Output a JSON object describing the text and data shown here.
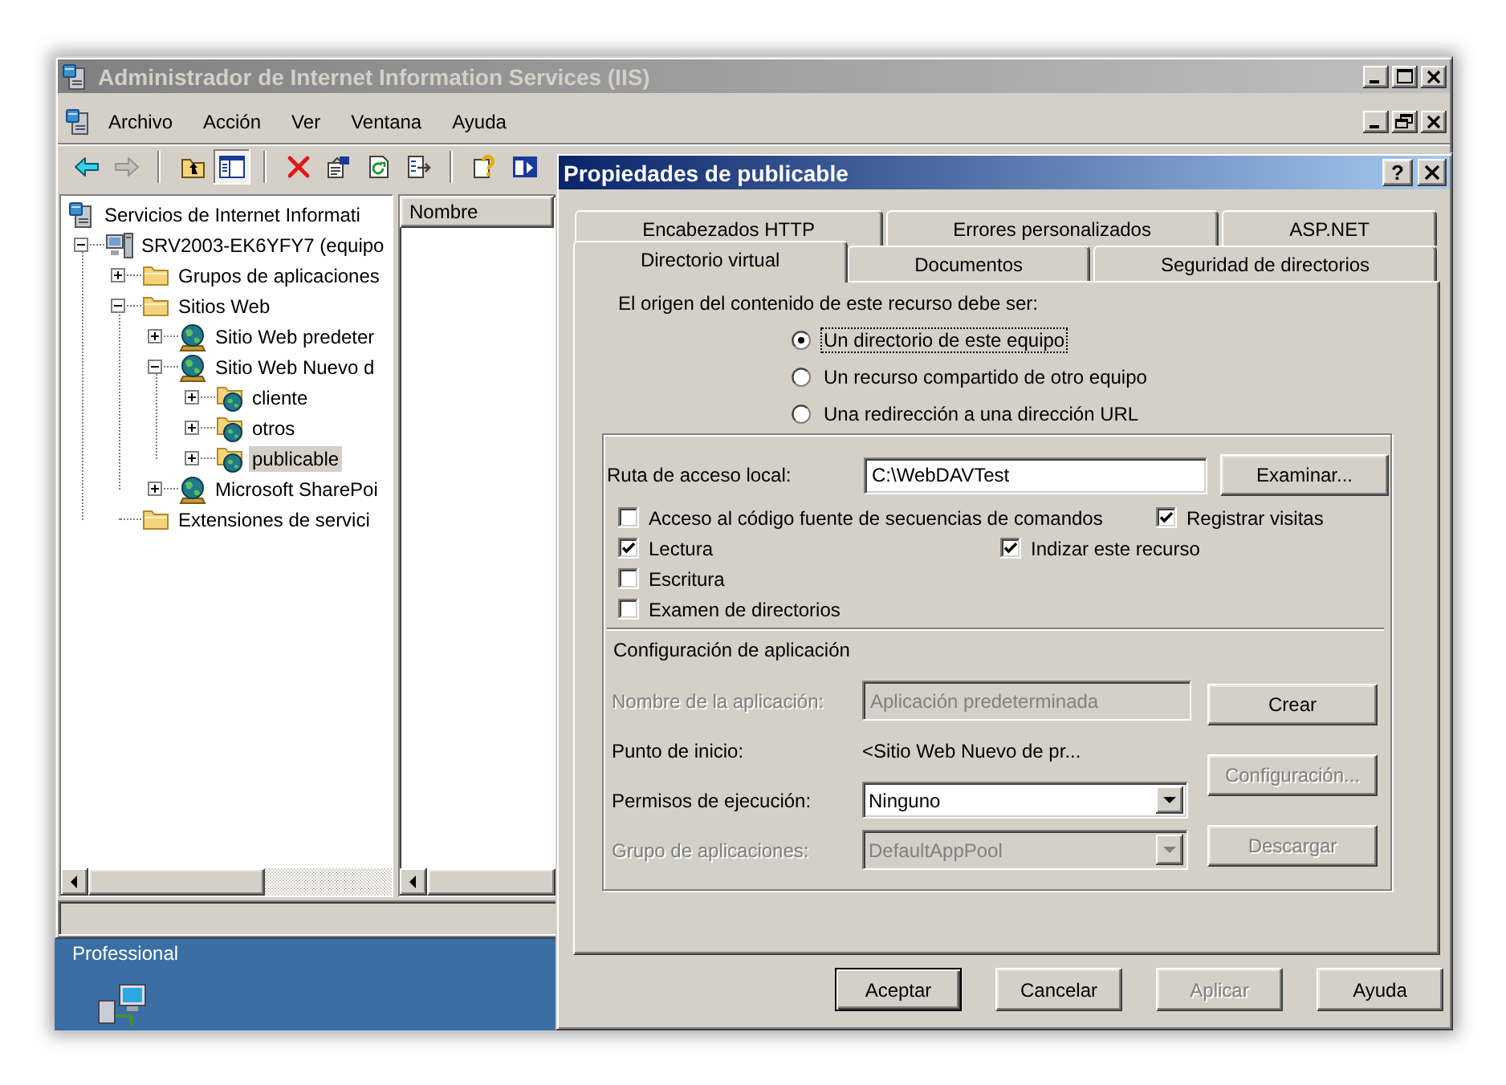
{
  "main_window": {
    "title": "Administrador de Internet Information Services (IIS)",
    "active": false,
    "menu": [
      "Archivo",
      "Acción",
      "Ver",
      "Ventana",
      "Ayuda"
    ],
    "toolbar": [
      {
        "kind": "back",
        "disabled": false,
        "pressed": false
      },
      {
        "kind": "forward",
        "disabled": true,
        "pressed": false
      },
      {
        "kind": "separator"
      },
      {
        "kind": "up",
        "disabled": false,
        "pressed": false
      },
      {
        "kind": "tree",
        "disabled": false,
        "pressed": true
      },
      {
        "kind": "separator"
      },
      {
        "kind": "delete",
        "disabled": false,
        "pressed": false
      },
      {
        "kind": "properties",
        "disabled": false,
        "pressed": false
      },
      {
        "kind": "refresh",
        "disabled": false,
        "pressed": false
      },
      {
        "kind": "export",
        "disabled": false,
        "pressed": false
      },
      {
        "kind": "separator"
      },
      {
        "kind": "help",
        "disabled": false,
        "pressed": false
      },
      {
        "kind": "pane",
        "disabled": false,
        "pressed": false
      }
    ],
    "tree": [
      {
        "label": "Servicios de Internet Informati",
        "kind": "root",
        "selected": false,
        "children": [
          {
            "label": "SRV2003-EK6YFY7 (equipo",
            "kind": "server",
            "expanded": true,
            "selected": false,
            "children": [
              {
                "label": "Grupos de aplicaciones",
                "kind": "folder",
                "expanded": false,
                "selected": false
              },
              {
                "label": "Sitios Web",
                "kind": "folder",
                "expanded": true,
                "selected": false,
                "children": [
                  {
                    "label": "Sitio Web predeter",
                    "kind": "site",
                    "expanded": false,
                    "selected": false
                  },
                  {
                    "label": "Sitio Web Nuevo d",
                    "kind": "site",
                    "expanded": true,
                    "selected": false,
                    "children": [
                      {
                        "label": "cliente",
                        "kind": "virtual_directory",
                        "expanded": false,
                        "selected": false
                      },
                      {
                        "label": "otros",
                        "kind": "virtual_directory",
                        "expanded": false,
                        "selected": false
                      },
                      {
                        "label": "publicable",
                        "kind": "virtual_directory",
                        "expanded": false,
                        "selected": true
                      }
                    ]
                  },
                  {
                    "label": "Microsoft SharePoi",
                    "kind": "site",
                    "expanded": false,
                    "selected": false
                  }
                ]
              },
              {
                "label": "Extensiones de servici",
                "kind": "folder",
                "selected": false
              }
            ]
          }
        ]
      }
    ],
    "list_columns": [
      "Nombre"
    ]
  },
  "dialog": {
    "title": "Propiedades de publicable",
    "active": true,
    "help_button": "?",
    "tab_rows": [
      [
        {
          "label": "Encabezados HTTP",
          "selected": false
        },
        {
          "label": "Errores personalizados",
          "selected": false
        },
        {
          "label": "ASP.NET",
          "selected": false
        }
      ],
      [
        {
          "label": "Directorio virtual",
          "selected": true
        },
        {
          "label": "Documentos",
          "selected": false
        },
        {
          "label": "Seguridad de directorios",
          "selected": false
        }
      ]
    ],
    "source_prompt": "El origen del contenido de este recurso debe ser:",
    "source_options": [
      {
        "label": "Un directorio de este equipo",
        "selected": true,
        "focused": true
      },
      {
        "label": "Un recurso compartido de otro equipo",
        "selected": false,
        "focused": false
      },
      {
        "label": "Una redirección a una dirección URL",
        "selected": false,
        "focused": false
      }
    ],
    "local_path": {
      "label": "Ruta de acceso local:",
      "value": "C:\\WebDAVTest"
    },
    "browse_button": {
      "label": "Examinar...",
      "disabled": false
    },
    "permissions": [
      {
        "label": "Acceso al código fuente de secuencias de comandos",
        "checked": false
      },
      {
        "label": "Registrar visitas",
        "checked": true
      },
      {
        "label": "Lectura",
        "checked": true
      },
      {
        "label": "Indizar este recurso",
        "checked": true
      },
      {
        "label": "Escritura",
        "checked": false
      },
      {
        "label": "Examen de directorios",
        "checked": false
      }
    ],
    "app_config": {
      "heading": "Configuración de aplicación",
      "rows": [
        {
          "label": "Nombre de la aplicación:",
          "disabled": true,
          "field": {
            "kind": "text",
            "value": "Aplicación predeterminada",
            "disabled": true
          }
        },
        {
          "label": "Punto de inicio:",
          "disabled": false,
          "field": {
            "kind": "static",
            "value": "<Sitio Web Nuevo de pr..."
          }
        },
        {
          "label": "Permisos de ejecución:",
          "disabled": false,
          "field": {
            "kind": "select",
            "value": "Ninguno",
            "disabled": false
          }
        },
        {
          "label": "Grupo de aplicaciones:",
          "disabled": true,
          "field": {
            "kind": "select",
            "value": "DefaultAppPool",
            "disabled": true
          }
        }
      ],
      "buttons": [
        {
          "label": "Crear",
          "disabled": false
        },
        {
          "label": "Configuración...",
          "disabled": true
        },
        {
          "label": "Descargar",
          "disabled": true
        }
      ]
    },
    "buttons": [
      {
        "label": "Aceptar",
        "default": true,
        "disabled": false
      },
      {
        "label": "Cancelar",
        "default": false,
        "disabled": false
      },
      {
        "label": "Aplicar",
        "default": false,
        "disabled": true
      },
      {
        "label": "Ayuda",
        "default": false,
        "disabled": false
      }
    ]
  },
  "desktop": {
    "label": "Professional"
  }
}
